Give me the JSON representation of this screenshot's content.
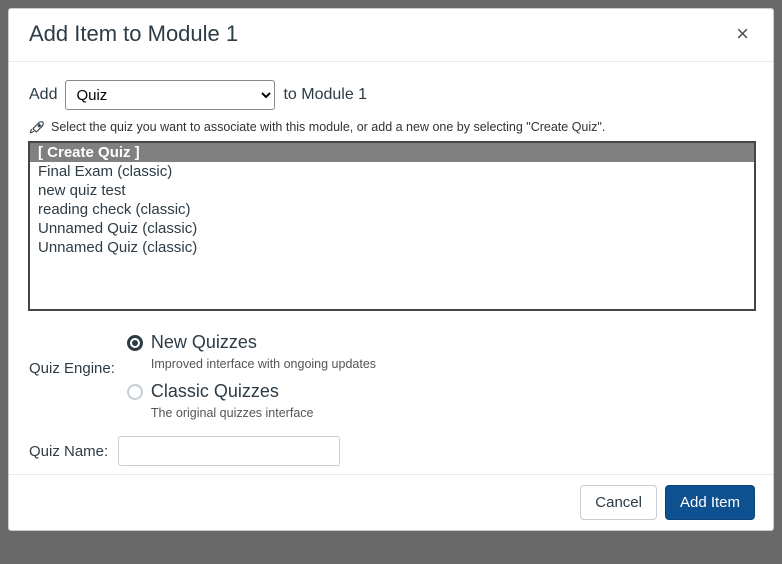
{
  "header": {
    "title": "Add Item to Module 1"
  },
  "addRow": {
    "prefix": "Add",
    "selected": "Quiz",
    "suffix": "to Module 1"
  },
  "hint": "Select the quiz you want to associate with this module, or add a new one by selecting \"Create Quiz\".",
  "quizList": {
    "items": [
      "[ Create Quiz ]",
      "Final Exam (classic)",
      "new quiz test",
      "reading check (classic)",
      "Unnamed Quiz (classic)",
      "Unnamed Quiz (classic)"
    ],
    "selectedIndex": 0
  },
  "engine": {
    "label": "Quiz Engine:",
    "options": [
      {
        "label": "New Quizzes",
        "desc": "Improved interface with ongoing updates",
        "checked": true
      },
      {
        "label": "Classic Quizzes",
        "desc": "The original quizzes interface",
        "checked": false
      }
    ]
  },
  "quizName": {
    "label": "Quiz Name:",
    "value": ""
  },
  "footer": {
    "cancel": "Cancel",
    "add": "Add Item"
  }
}
